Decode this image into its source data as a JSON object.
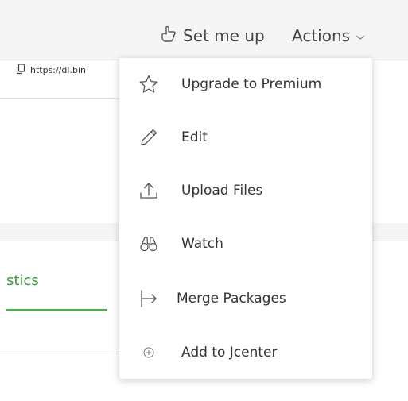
{
  "header": {
    "setup_label": "Set me up",
    "actions_label": "Actions",
    "icons": {
      "setup": "pointer-hand-icon",
      "actions": "chevron-down-icon"
    }
  },
  "repo": {
    "url": "https://dl.bin",
    "url_icon": "copy-icon"
  },
  "tabs": {
    "active_label": "stics"
  },
  "menu": {
    "items": [
      {
        "label": "Upgrade to Premium",
        "icon": "star-icon"
      },
      {
        "label": "Edit",
        "icon": "pencil-icon"
      },
      {
        "label": "Upload Files",
        "icon": "upload-icon"
      },
      {
        "label": "Watch",
        "icon": "binoculars-icon"
      },
      {
        "label": "Merge Packages",
        "icon": "merge-icon"
      },
      {
        "label": "Add to Jcenter",
        "icon": "add-circle-icon"
      }
    ]
  },
  "colors": {
    "accent": "#4ca64c",
    "background": "#f5f5f5",
    "text": "#333333"
  }
}
